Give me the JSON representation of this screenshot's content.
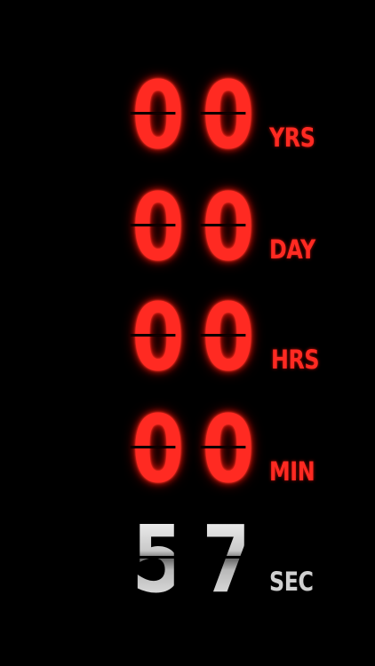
{
  "countdown": {
    "years": {
      "digit_1": "0",
      "digit_2": "0",
      "unit": "YRS"
    },
    "days": {
      "digit_1": "0",
      "digit_2": "0",
      "unit": "DAY"
    },
    "hours": {
      "digit_1": "0",
      "digit_2": "0",
      "unit": "HRS"
    },
    "minutes": {
      "digit_1": "0",
      "digit_2": "0",
      "unit": "MIN"
    },
    "seconds": {
      "digit_1": "5",
      "digit_2": "7",
      "unit": "SEC"
    }
  },
  "colors": {
    "background": "#000000",
    "active_red": "#ff2a22",
    "seconds_silver": "#d0d0d0"
  }
}
